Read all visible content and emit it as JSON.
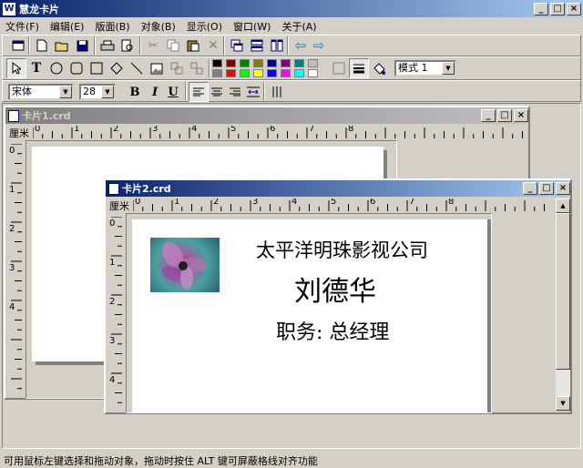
{
  "app": {
    "title": "慧龙卡片",
    "app_icon": "W"
  },
  "menu": [
    "文件(F)",
    "编辑(E)",
    "版面(B)",
    "对象(B)",
    "显示(O)",
    "窗口(W)",
    "关于(A)"
  ],
  "toolbar_text": {
    "font_name": "宋体",
    "font_size": "28",
    "mode": "模式 1",
    "bold": "B",
    "italic": "I",
    "underline": "U"
  },
  "colors": {
    "row1": [
      "#000000",
      "#800000",
      "#008000",
      "#808000",
      "#000080",
      "#800080",
      "#008080",
      "#c0c0c0"
    ],
    "row2": [
      "#808080",
      "#ff0000",
      "#00ff00",
      "#ffff00",
      "#0000ff",
      "#ff00ff",
      "#00ffff",
      "#ffffff"
    ]
  },
  "window1": {
    "title": "卡片1.crd",
    "ruler_unit": "厘米",
    "ruler_numbers": [
      "0",
      "1",
      "2",
      "3",
      "4",
      "5",
      "6",
      "7",
      "8"
    ],
    "vruler_numbers": [
      "0",
      "1",
      "2",
      "3",
      "4"
    ]
  },
  "window2": {
    "title": "卡片2.crd",
    "ruler_unit": "厘米",
    "ruler_numbers": [
      "0",
      "1",
      "2",
      "3",
      "4",
      "5",
      "6",
      "7",
      "8"
    ],
    "vruler_numbers": [
      "0",
      "1",
      "2",
      "3",
      "4"
    ]
  },
  "card": {
    "company": "太平洋明珠影视公司",
    "name": "刘德华",
    "position": "职务: 总经理"
  },
  "status": "可用鼠标左键选择和拖动对象，拖动时按住 ALT 键可屏蔽格线对齐功能"
}
